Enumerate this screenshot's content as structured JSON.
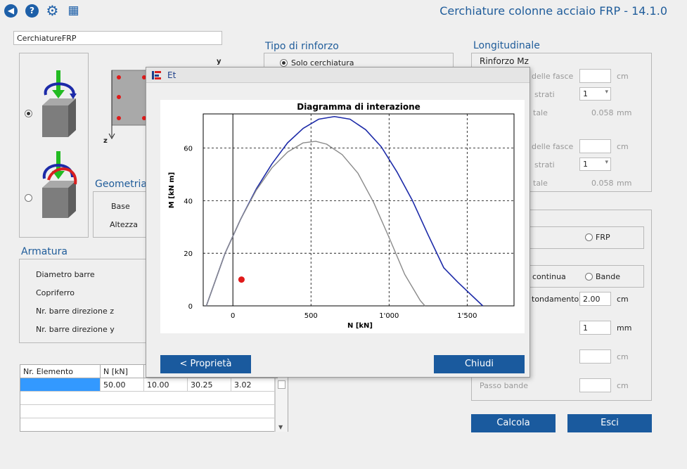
{
  "toolbar": {
    "back_glyph": "◀",
    "help_glyph": "?",
    "settings_glyph": "⚙",
    "calc_glyph": "▦"
  },
  "app_title": "Cerchiature colonne acciaio FRP - 14.1.0",
  "project_name": "CerchiatureFRP",
  "section_labels": {
    "y": "y",
    "z": "z"
  },
  "geometria": {
    "title": "Geometria",
    "base_label": "Base",
    "altezza_label": "Altezza"
  },
  "armatura": {
    "title": "Armatura",
    "diametro_label": "Diametro barre",
    "copriferro_label": "Copriferro",
    "nr_z_label": "Nr. barre direzione z",
    "nr_y_label": "Nr. barre direzione y"
  },
  "tipo_rinforzo": {
    "title": "Tipo di rinforzo",
    "option_label": "Solo cerchiatura"
  },
  "longitudinale": {
    "title": "Longitudinale",
    "rinforzo_label": "Rinforzo Mz",
    "fasce_label_1": "delle fasce",
    "strati_label_1": "strati",
    "strati_value_1": "1",
    "tale_label_1": "tale",
    "tale_value_1": "0.058",
    "fasce_label_2": "delle fasce",
    "strati_label_2": "strati",
    "strati_value_2": "1",
    "tale_label_2": "tale",
    "tale_value_2": "0.058",
    "unit_cm": "cm",
    "unit_mm": "mm"
  },
  "trasversale": {
    "frp_label": "FRP",
    "continua_label": "continua",
    "bande_label": "Bande",
    "arrotondamento_label": "tondamento",
    "arrotondamento_value": "2.00",
    "arrotondamento_unit": "cm",
    "field2_value": "1",
    "field2_unit": "mm",
    "field3_unit": "cm",
    "passo_label": "Passo bande",
    "passo_unit": "cm"
  },
  "table": {
    "headers": [
      "Nr. Elemento",
      "N [kN]"
    ],
    "row1": [
      "",
      "50.00",
      "10.00",
      "30.25",
      "3.02"
    ]
  },
  "dialog": {
    "title": "Et",
    "back_button": "<  Proprietà",
    "close_button": "Chiudi"
  },
  "buttons": {
    "calcola": "Calcola",
    "esci": "Esci"
  },
  "chart_data": {
    "type": "line",
    "title": "Diagramma di interazione",
    "xlabel": "N [kN]",
    "ylabel": "M [kN m]",
    "xlim": [
      -190,
      1800
    ],
    "ylim": [
      0,
      73
    ],
    "xticks": [
      0,
      500,
      1000,
      1500
    ],
    "xtick_labels": [
      "0",
      "500",
      "1'000",
      "1'500"
    ],
    "yticks": [
      0,
      20,
      40,
      60
    ],
    "ytick_labels": [
      "0",
      "20",
      "40",
      "60"
    ],
    "grid": true,
    "colors": {
      "outer": "#1c2aa8",
      "inner": "#8a8a8a",
      "point": "#e01a1a"
    },
    "series": [
      {
        "x": [
          -170,
          -50,
          50,
          150,
          250,
          350,
          450,
          550,
          650,
          750,
          850,
          950,
          1050,
          1150,
          1250,
          1350,
          1440,
          1600
        ],
        "y": [
          0,
          20,
          33,
          44.5,
          54,
          62,
          67.5,
          71,
          72,
          71,
          67,
          60.5,
          51,
          40,
          27,
          14.5,
          9,
          0
        ]
      },
      {
        "x": [
          -170,
          -50,
          50,
          150,
          250,
          350,
          450,
          530,
          600,
          700,
          800,
          900,
          1000,
          1100,
          1200,
          1230
        ],
        "y": [
          0,
          20,
          33,
          44,
          52.5,
          58.5,
          62,
          62.6,
          61.5,
          57.5,
          50.5,
          39.5,
          26,
          12,
          2,
          0
        ]
      }
    ],
    "point": {
      "x": 55,
      "y": 10
    }
  }
}
